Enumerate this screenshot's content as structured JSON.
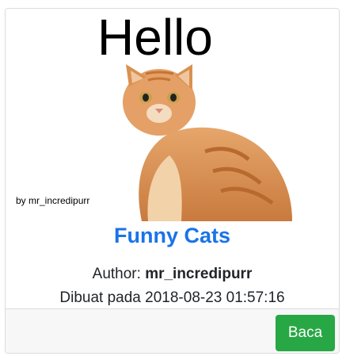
{
  "card": {
    "cover": {
      "hello_text": "Hello",
      "byline_text": "by mr_incredipurr",
      "image": "orange-tabby-cat-photo"
    },
    "title": "Funny Cats",
    "author_label": "Author:",
    "author_name": "mr_incredipurr",
    "date_text": "Dibuat pada 2018-08-23 01:57:16",
    "read_button_label": "Baca"
  },
  "colors": {
    "title": "#1a73e8",
    "button": "#28a745",
    "footer": "#f7f7f7",
    "border": "#dcdcdc"
  }
}
